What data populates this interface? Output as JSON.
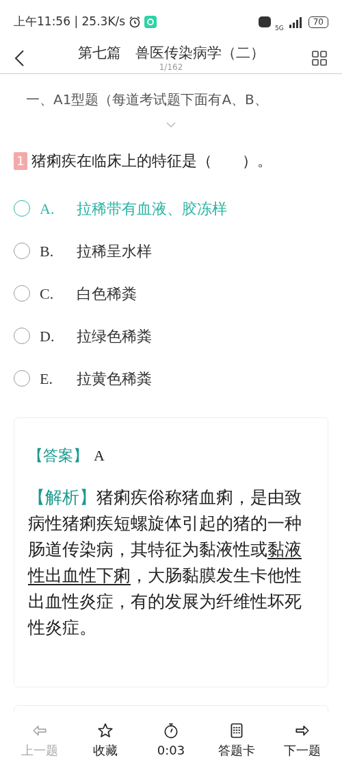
{
  "status_bar": {
    "time": "上午11:56 | 25.3K/s",
    "network": "5G",
    "battery": "70"
  },
  "header": {
    "title": "第七篇　兽医传染病学（二）",
    "progress": "1/162"
  },
  "instruction": "一、A1型题（每道考试题下面有A、B、",
  "question": {
    "number": "1",
    "text": "猪痢疾在临床上的特征是（　　）。"
  },
  "options": [
    {
      "letter": "A.",
      "text": "拉稀带有血液、胶冻样",
      "selected": true
    },
    {
      "letter": "B.",
      "text": "拉稀呈水样",
      "selected": false
    },
    {
      "letter": "C.",
      "text": "白色稀粪",
      "selected": false
    },
    {
      "letter": "D.",
      "text": "拉绿色稀粪",
      "selected": false
    },
    {
      "letter": "E.",
      "text": "拉黄色稀粪",
      "selected": false
    }
  ],
  "answer": {
    "label": "【答案】",
    "value": "A"
  },
  "analysis": {
    "label": "【解析】",
    "segments": [
      {
        "text": "猪痢疾俗称猪血痢，是由致病性猪痢疾短螺旋体引起的猪的一种肠道传染病，其特征为黏液性或",
        "underlined": false
      },
      {
        "text": "黏液性出血性下痢",
        "underlined": true
      },
      {
        "text": "，大肠黏膜发生卡他性出血性炎症，有的发展为纤维性坏死性炎症。",
        "underlined": false
      }
    ]
  },
  "bottom_nav": [
    {
      "kind": "prev",
      "label": "上一题",
      "disabled": true
    },
    {
      "kind": "favorite",
      "label": "收藏",
      "disabled": false
    },
    {
      "kind": "timer",
      "label": "0:03",
      "disabled": false
    },
    {
      "kind": "card",
      "label": "答题卡",
      "disabled": false
    },
    {
      "kind": "next",
      "label": "下一题",
      "disabled": false
    }
  ]
}
